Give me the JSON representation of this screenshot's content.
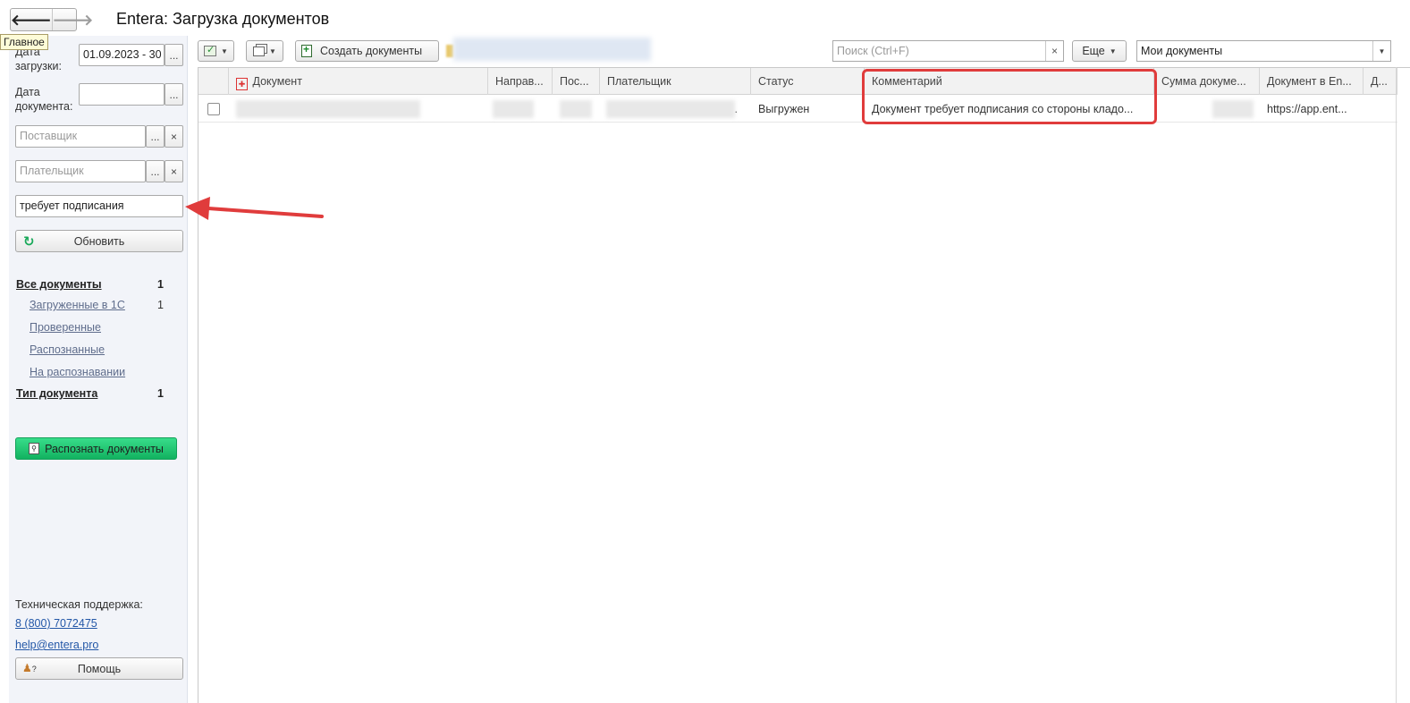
{
  "window": {
    "title": "Entera: Загрузка документов",
    "tooltip": "Главное"
  },
  "filters": {
    "upload_date_label": "Дата загрузки:",
    "upload_date_value": "01.09.2023 - 30",
    "document_date_label": "Дата документа:",
    "document_date_value": "",
    "supplier_placeholder": "Поставщик",
    "payer_placeholder": "Плательщик",
    "search_value": "требует подписания",
    "ellipsis": "...",
    "clear": "×",
    "refresh_label": "Обновить"
  },
  "sections": {
    "all_docs": {
      "label": "Все документы",
      "count": "1"
    },
    "items": [
      {
        "label": "Загруженные в 1С",
        "count": "1"
      },
      {
        "label": "Проверенные",
        "count": ""
      },
      {
        "label": "Распознанные",
        "count": ""
      },
      {
        "label": "На распознавании",
        "count": ""
      }
    ],
    "doc_type": {
      "label": "Тип документа",
      "count": "1"
    }
  },
  "actions": {
    "recognize_label": "Распознать документы",
    "create_label": "Создать документы",
    "more_label": "Еще",
    "help_label": "Помощь"
  },
  "support": {
    "label": "Техническая поддержка:",
    "phone": "8 (800) 7072475",
    "email": "help@entera.pro"
  },
  "toolbar": {
    "search_placeholder": "Поиск (Ctrl+F)",
    "search_clear": "×",
    "view_select_value": "Мои документы"
  },
  "table": {
    "columns": [
      "Документ",
      "Направ...",
      "Пос...",
      "Плательщик",
      "Статус",
      "Комментарий",
      "Сумма докуме...",
      "Документ в En...",
      "Д..."
    ],
    "rows": [
      {
        "document": "",
        "direction": "",
        "pos": "",
        "payer": ".",
        "status": "Выгружен",
        "comment": "Документ требует подписания со стороны кладо...",
        "amount": "",
        "link": "https://app.ent...",
        "d": ""
      }
    ]
  },
  "colors": {
    "accent_green": "#1cc26d",
    "highlight_red": "#e03c3c",
    "panel_bg": "#f2f4f9",
    "link": "#2357a7"
  },
  "icons": {
    "back": "arrow-left-icon",
    "forward": "arrow-right-icon",
    "refresh": "refresh-icon",
    "pdf": "pdf-icon",
    "help": "user-help-icon"
  }
}
